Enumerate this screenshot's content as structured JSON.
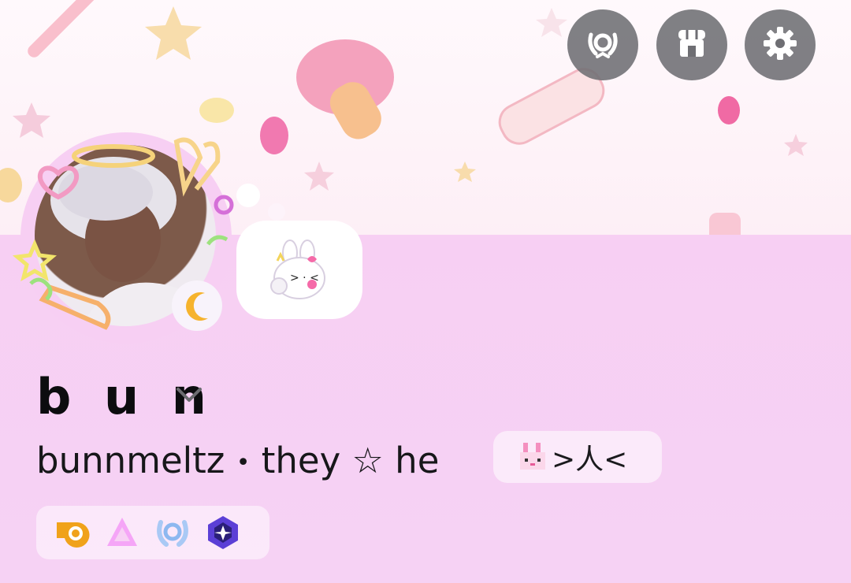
{
  "profile": {
    "display_name": "b u n",
    "username": "bunnmeltz",
    "separator": "•",
    "pronouns": "they ☆ he",
    "pronoun_tag": ">人<",
    "status_emoji": "bunny-sticker",
    "decor_icons": [
      "heart-icon",
      "bunny-ears-icon",
      "carrot-icon",
      "moon-icon",
      "star-icon",
      "halo-icon"
    ]
  },
  "top_buttons": [
    "nitro-laurel-icon",
    "shop-icon",
    "gear-icon"
  ],
  "badges": [
    "hypesquad-icon",
    "triangle-badge-icon",
    "laurel-badge-icon",
    "diamond-badge-icon"
  ],
  "colors": {
    "accent": "#f6d0f4",
    "button_bg": "#6e6e73"
  }
}
